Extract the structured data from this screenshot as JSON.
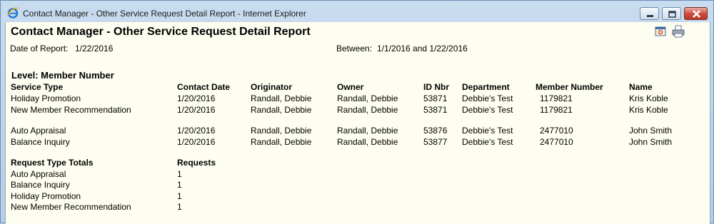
{
  "window": {
    "title": "Contact Manager - Other Service Request Detail Report - Internet Explorer"
  },
  "report": {
    "title": "Contact Manager - Other Service Request Detail Report",
    "date_label": "Date of Report:",
    "date_value": "1/22/2016",
    "between_label": "Between:",
    "between_value": "1/1/2016 and 1/22/2016",
    "level": "Level: Member Number"
  },
  "table": {
    "headers": [
      "Service Type",
      "Contact Date",
      "Originator",
      "Owner",
      "ID Nbr",
      "Department",
      "Member Number",
      "Name"
    ],
    "rows": [
      [
        "Holiday Promotion",
        "1/20/2016",
        "Randall, Debbie",
        "Randall, Debbie",
        "53871",
        "Debbie's Test",
        "1179821",
        "Kris Koble"
      ],
      [
        "New Member Recommendation",
        "1/20/2016",
        "Randall, Debbie",
        "Randall, Debbie",
        "53871",
        "Debbie's Test",
        "1179821",
        "Kris Koble"
      ],
      [
        "Auto Appraisal",
        "1/20/2016",
        "Randall, Debbie",
        "Randall, Debbie",
        "53876",
        "Debbie's Test",
        "2477010",
        "John Smith"
      ],
      [
        "Balance Inquiry",
        "1/20/2016",
        "Randall, Debbie",
        "Randall, Debbie",
        "53877",
        "Debbie's Test",
        "2477010",
        "John Smith"
      ]
    ]
  },
  "totals": {
    "headers": [
      "Request Type Totals",
      "Requests"
    ],
    "rows": [
      [
        "Auto Appraisal",
        "1"
      ],
      [
        "Balance Inquiry",
        "1"
      ],
      [
        "Holiday Promotion",
        "1"
      ],
      [
        "New Member Recommendation",
        "1"
      ]
    ]
  },
  "icons": {
    "browser": "internet-explorer-icon",
    "toolbar": [
      "export-icon",
      "print-icon"
    ]
  }
}
